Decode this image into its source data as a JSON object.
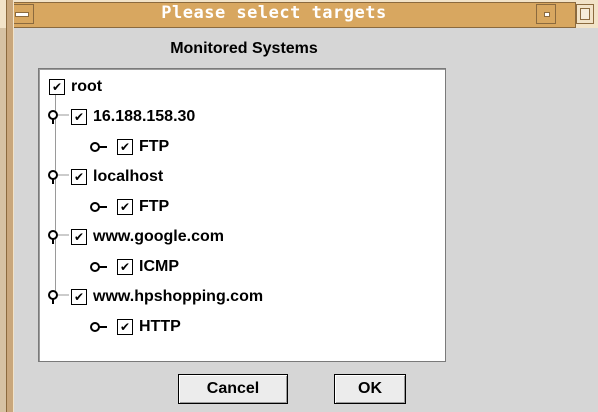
{
  "window": {
    "title": "Please select targets",
    "colors": {
      "title_bar": "#d8a760",
      "frame": "#c9a77c",
      "content_bg": "#d6d6d6"
    }
  },
  "heading": "Monitored Systems",
  "tree": {
    "root": {
      "label": "root",
      "checked": true
    },
    "nodes": [
      {
        "label": "16.188.158.30",
        "checked": true,
        "child": {
          "label": "FTP",
          "checked": true
        }
      },
      {
        "label": "localhost",
        "checked": true,
        "child": {
          "label": "FTP",
          "checked": true
        }
      },
      {
        "label": "www.google.com",
        "checked": true,
        "child": {
          "label": "ICMP",
          "checked": true
        }
      },
      {
        "label": "www.hpshopping.com",
        "checked": true,
        "child": {
          "label": "HTTP",
          "checked": true
        }
      }
    ],
    "check_mark": "✔"
  },
  "buttons": {
    "cancel": "Cancel",
    "ok": "OK"
  },
  "icons": {
    "window_menu": "window-menu-icon",
    "minimize": "minimize-icon",
    "maximize": "maximize-icon",
    "node_expanded": "tree-expanded-handle-icon",
    "leaf": "tree-leaf-handle-icon"
  }
}
